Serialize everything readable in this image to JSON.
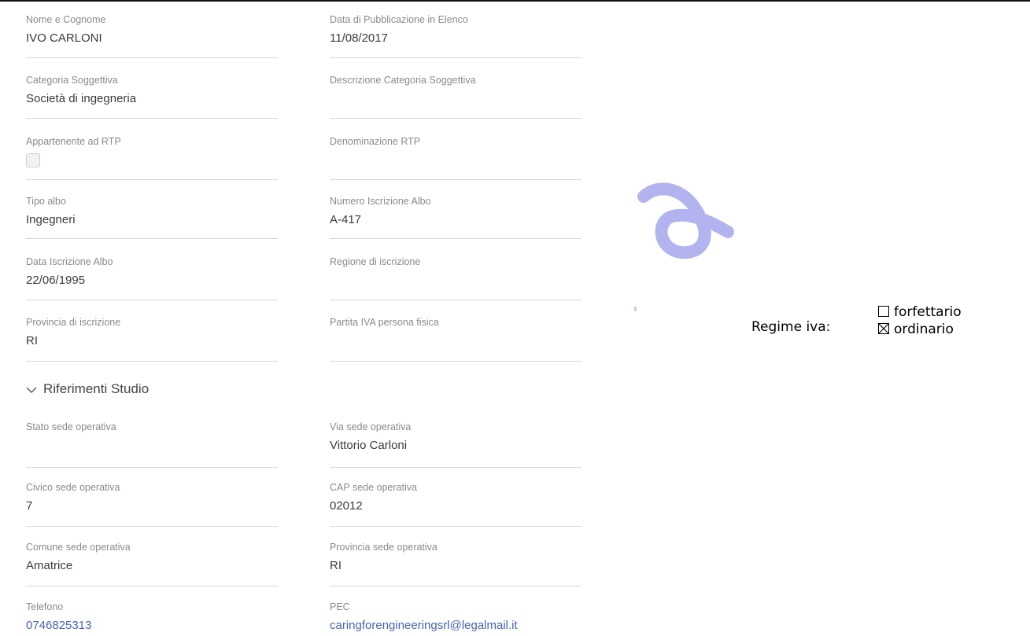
{
  "fields": [
    {
      "label": "Nome e Cognome",
      "value": "IVO CARLONI"
    },
    {
      "label": "Data di Pubblicazione in Elenco",
      "value": "11/08/2017"
    },
    {
      "label": "Categoria Soggettiva",
      "value": "Società di ingegneria"
    },
    {
      "label": "Descrizione Categoria Soggettiva",
      "value": ""
    },
    {
      "label": "Appartenente ad RTP",
      "value": ""
    },
    {
      "label": "Denominazione RTP",
      "value": ""
    },
    {
      "label": "Tipo albo",
      "value": "Ingegneri"
    },
    {
      "label": "Numero Iscrizione Albo",
      "value": "A-417"
    },
    {
      "label": "Data Iscrizione Albo",
      "value": "22/06/1995"
    },
    {
      "label": "Regione di iscrizione",
      "value": ""
    },
    {
      "label": "Provincia di iscrizione",
      "value": "RI"
    },
    {
      "label": "Partita IVA persona fisica",
      "value": ""
    }
  ],
  "section_title": "Riferimenti Studio",
  "studio_fields": [
    {
      "label": "Stato sede operativa",
      "value": ""
    },
    {
      "label": "Via sede operativa",
      "value": "Vittorio Carloni"
    },
    {
      "label": "Civico sede operativa",
      "value": "7"
    },
    {
      "label": "CAP sede operativa",
      "value": "02012"
    },
    {
      "label": "Comune sede operativa",
      "value": "Amatrice"
    },
    {
      "label": "Provincia sede operativa",
      "value": "RI"
    },
    {
      "label": "Telefono",
      "value": "0746825313"
    },
    {
      "label": "PEC",
      "value": "caringforengineeringsrl@legalmail.it"
    }
  ],
  "rtp_checkbox_checked": false,
  "regime": {
    "label": "Regime iva:",
    "options": [
      {
        "label": "forfettario",
        "checked": false
      },
      {
        "label": "ordinario",
        "checked": true
      }
    ]
  },
  "colors": {
    "link": "#4a63b5",
    "logo": "#b3b4ef"
  }
}
